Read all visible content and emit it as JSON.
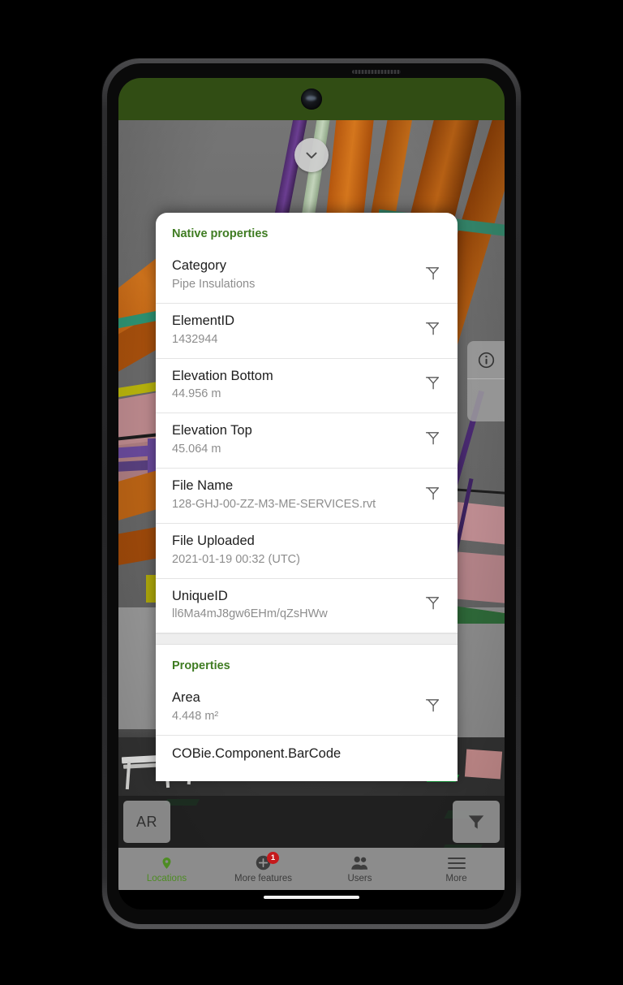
{
  "device": {
    "status_bar_color": "#314d14",
    "camera": "front-camera-punchhole"
  },
  "viewport": {
    "collapse_button_icon": "chevron-down-icon",
    "info_button_icon": "info-icon"
  },
  "action_bar": {
    "ar_label": "AR",
    "filter_icon": "filter-funnel-filled-icon"
  },
  "bottom_nav": {
    "items": [
      {
        "label": "Locations",
        "icon": "map-pin-icon",
        "active": true,
        "badge": null
      },
      {
        "label": "More features",
        "icon": "plus-circle-icon",
        "active": false,
        "badge": "1"
      },
      {
        "label": "Users",
        "icon": "users-icon",
        "active": false,
        "badge": null
      },
      {
        "label": "More",
        "icon": "hamburger-icon",
        "active": false,
        "badge": null
      }
    ],
    "active_color": "#4e8c23",
    "badge_color": "#c5191c"
  },
  "sheet": {
    "sections": [
      {
        "title": "Native properties",
        "rows": [
          {
            "key": "Category",
            "value": "Pipe Insulations",
            "filter": true
          },
          {
            "key": "ElementID",
            "value": "1432944",
            "filter": true
          },
          {
            "key": "Elevation Bottom",
            "value": "44.956 m",
            "filter": true
          },
          {
            "key": "Elevation Top",
            "value": "45.064 m",
            "filter": true
          },
          {
            "key": "File Name",
            "value": "128-GHJ-00-ZZ-M3-ME-SERVICES.rvt",
            "filter": true
          },
          {
            "key": "File Uploaded",
            "value": "2021-01-19 00:32 (UTC)",
            "filter": false
          },
          {
            "key": "UniqueID",
            "value": "ll6Ma4mJ8gw6EHm/qZsHWw",
            "filter": true
          }
        ]
      },
      {
        "title": "Properties",
        "rows": [
          {
            "key": "Area",
            "value": "4.448 m²",
            "filter": true
          },
          {
            "key": "COBie.Component.BarCode",
            "value": "",
            "filter": false
          }
        ]
      }
    ],
    "section_title_color": "#3f7c22",
    "filter_icon": "filter-funnel-outline-icon"
  }
}
